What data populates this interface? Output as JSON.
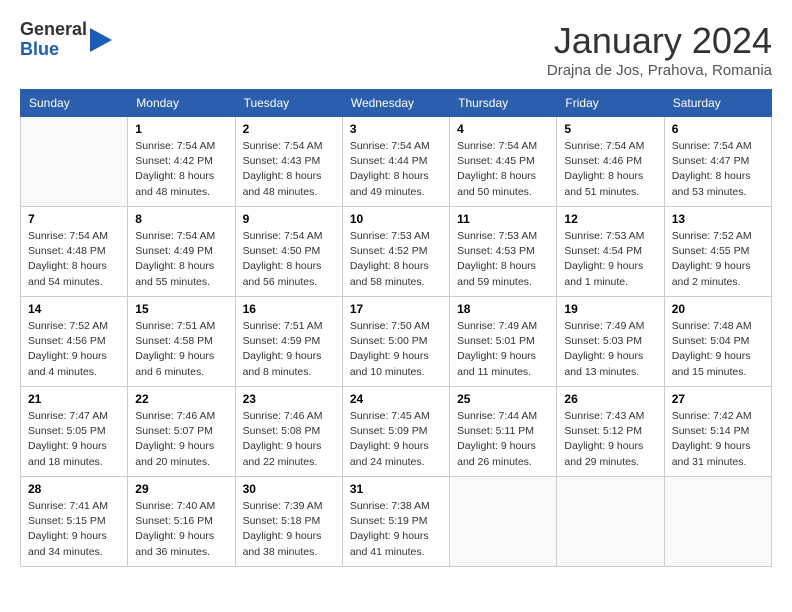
{
  "logo": {
    "line1": "General",
    "line2": "Blue"
  },
  "title": "January 2024",
  "subtitle": "Drajna de Jos, Prahova, Romania",
  "days_of_week": [
    "Sunday",
    "Monday",
    "Tuesday",
    "Wednesday",
    "Thursday",
    "Friday",
    "Saturday"
  ],
  "weeks": [
    [
      {
        "day": "",
        "info": ""
      },
      {
        "day": "1",
        "info": "Sunrise: 7:54 AM\nSunset: 4:42 PM\nDaylight: 8 hours\nand 48 minutes."
      },
      {
        "day": "2",
        "info": "Sunrise: 7:54 AM\nSunset: 4:43 PM\nDaylight: 8 hours\nand 48 minutes."
      },
      {
        "day": "3",
        "info": "Sunrise: 7:54 AM\nSunset: 4:44 PM\nDaylight: 8 hours\nand 49 minutes."
      },
      {
        "day": "4",
        "info": "Sunrise: 7:54 AM\nSunset: 4:45 PM\nDaylight: 8 hours\nand 50 minutes."
      },
      {
        "day": "5",
        "info": "Sunrise: 7:54 AM\nSunset: 4:46 PM\nDaylight: 8 hours\nand 51 minutes."
      },
      {
        "day": "6",
        "info": "Sunrise: 7:54 AM\nSunset: 4:47 PM\nDaylight: 8 hours\nand 53 minutes."
      }
    ],
    [
      {
        "day": "7",
        "info": "Sunrise: 7:54 AM\nSunset: 4:48 PM\nDaylight: 8 hours\nand 54 minutes."
      },
      {
        "day": "8",
        "info": "Sunrise: 7:54 AM\nSunset: 4:49 PM\nDaylight: 8 hours\nand 55 minutes."
      },
      {
        "day": "9",
        "info": "Sunrise: 7:54 AM\nSunset: 4:50 PM\nDaylight: 8 hours\nand 56 minutes."
      },
      {
        "day": "10",
        "info": "Sunrise: 7:53 AM\nSunset: 4:52 PM\nDaylight: 8 hours\nand 58 minutes."
      },
      {
        "day": "11",
        "info": "Sunrise: 7:53 AM\nSunset: 4:53 PM\nDaylight: 8 hours\nand 59 minutes."
      },
      {
        "day": "12",
        "info": "Sunrise: 7:53 AM\nSunset: 4:54 PM\nDaylight: 9 hours\nand 1 minute."
      },
      {
        "day": "13",
        "info": "Sunrise: 7:52 AM\nSunset: 4:55 PM\nDaylight: 9 hours\nand 2 minutes."
      }
    ],
    [
      {
        "day": "14",
        "info": "Sunrise: 7:52 AM\nSunset: 4:56 PM\nDaylight: 9 hours\nand 4 minutes."
      },
      {
        "day": "15",
        "info": "Sunrise: 7:51 AM\nSunset: 4:58 PM\nDaylight: 9 hours\nand 6 minutes."
      },
      {
        "day": "16",
        "info": "Sunrise: 7:51 AM\nSunset: 4:59 PM\nDaylight: 9 hours\nand 8 minutes."
      },
      {
        "day": "17",
        "info": "Sunrise: 7:50 AM\nSunset: 5:00 PM\nDaylight: 9 hours\nand 10 minutes."
      },
      {
        "day": "18",
        "info": "Sunrise: 7:49 AM\nSunset: 5:01 PM\nDaylight: 9 hours\nand 11 minutes."
      },
      {
        "day": "19",
        "info": "Sunrise: 7:49 AM\nSunset: 5:03 PM\nDaylight: 9 hours\nand 13 minutes."
      },
      {
        "day": "20",
        "info": "Sunrise: 7:48 AM\nSunset: 5:04 PM\nDaylight: 9 hours\nand 15 minutes."
      }
    ],
    [
      {
        "day": "21",
        "info": "Sunrise: 7:47 AM\nSunset: 5:05 PM\nDaylight: 9 hours\nand 18 minutes."
      },
      {
        "day": "22",
        "info": "Sunrise: 7:46 AM\nSunset: 5:07 PM\nDaylight: 9 hours\nand 20 minutes."
      },
      {
        "day": "23",
        "info": "Sunrise: 7:46 AM\nSunset: 5:08 PM\nDaylight: 9 hours\nand 22 minutes."
      },
      {
        "day": "24",
        "info": "Sunrise: 7:45 AM\nSunset: 5:09 PM\nDaylight: 9 hours\nand 24 minutes."
      },
      {
        "day": "25",
        "info": "Sunrise: 7:44 AM\nSunset: 5:11 PM\nDaylight: 9 hours\nand 26 minutes."
      },
      {
        "day": "26",
        "info": "Sunrise: 7:43 AM\nSunset: 5:12 PM\nDaylight: 9 hours\nand 29 minutes."
      },
      {
        "day": "27",
        "info": "Sunrise: 7:42 AM\nSunset: 5:14 PM\nDaylight: 9 hours\nand 31 minutes."
      }
    ],
    [
      {
        "day": "28",
        "info": "Sunrise: 7:41 AM\nSunset: 5:15 PM\nDaylight: 9 hours\nand 34 minutes."
      },
      {
        "day": "29",
        "info": "Sunrise: 7:40 AM\nSunset: 5:16 PM\nDaylight: 9 hours\nand 36 minutes."
      },
      {
        "day": "30",
        "info": "Sunrise: 7:39 AM\nSunset: 5:18 PM\nDaylight: 9 hours\nand 38 minutes."
      },
      {
        "day": "31",
        "info": "Sunrise: 7:38 AM\nSunset: 5:19 PM\nDaylight: 9 hours\nand 41 minutes."
      },
      {
        "day": "",
        "info": ""
      },
      {
        "day": "",
        "info": ""
      },
      {
        "day": "",
        "info": ""
      }
    ]
  ]
}
